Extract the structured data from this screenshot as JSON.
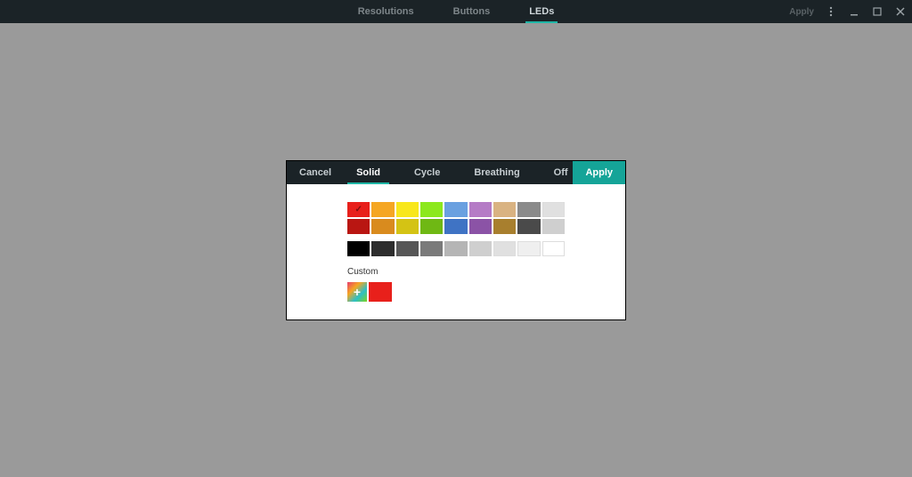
{
  "header": {
    "tabs": [
      "Resolutions",
      "Buttons",
      "LEDs"
    ],
    "activeIndex": 2,
    "apply": "Apply"
  },
  "dialog": {
    "cancel": "Cancel",
    "tabs": [
      "Solid",
      "Cycle",
      "Breathing",
      "Off"
    ],
    "activeIndex": 0,
    "apply": "Apply",
    "custom_label": "Custom",
    "add_symbol": "+",
    "selectedIndex": 0,
    "swatch_rows": [
      [
        "#e8201b",
        "#f5a623",
        "#f8e71c",
        "#8ce81d",
        "#6aa0e0",
        "#b57bc6",
        "#d9b382",
        "#8a8a8a",
        "#e0e0e0"
      ],
      [
        "#b91612",
        "#d98b1e",
        "#d4c314",
        "#6fb814",
        "#3f73c4",
        "#8b53a6",
        "#a87f2e",
        "#4a4a4a",
        "#cfcfcf"
      ],
      [
        "#000000",
        "#2d2d2d",
        "#575757",
        "#7a7a7a",
        "#b5b5b5",
        "#cfcfcf",
        "#e0e0e0",
        "#efefef",
        "#ffffff"
      ]
    ],
    "custom_swatches": [
      "#e8201b"
    ]
  }
}
